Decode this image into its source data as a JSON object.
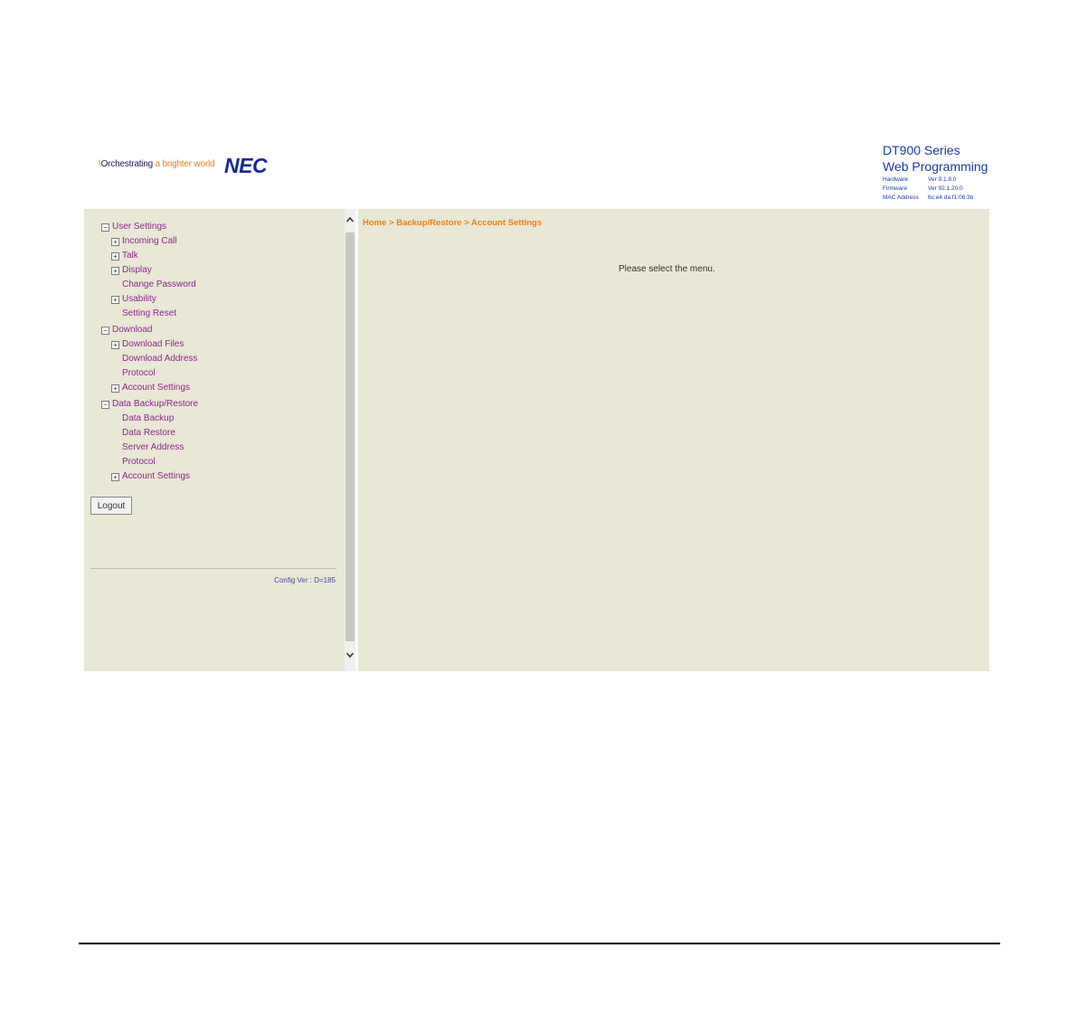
{
  "header": {
    "tagline_slash": "\\",
    "tagline_part1": "Orchestrating",
    "tagline_part2": " a brighter world",
    "logo_text": "NEC",
    "product_series": "DT900 Series",
    "product_title": "Web Programming",
    "info": [
      {
        "label": "Hardware",
        "value": "Ver 9.1.8.0"
      },
      {
        "label": "Firmware",
        "value": "Ver 92.1.20.0"
      },
      {
        "label": "MAC Address",
        "value": "6c:e4:da:f1:06:3b"
      }
    ]
  },
  "sidebar": {
    "user_settings": {
      "label": "User Settings",
      "toggle": "−",
      "items": [
        {
          "label": "Incoming Call",
          "toggle": "+"
        },
        {
          "label": "Talk",
          "toggle": "+"
        },
        {
          "label": "Display",
          "toggle": "+"
        },
        {
          "label": "Change Password"
        },
        {
          "label": "Usability",
          "toggle": "+"
        },
        {
          "label": "Setting Reset"
        }
      ]
    },
    "download": {
      "label": "Download",
      "toggle": "−",
      "items": [
        {
          "label": "Download Files",
          "toggle": "+"
        },
        {
          "label": "Download Address"
        },
        {
          "label": "Protocol"
        },
        {
          "label": "Account Settings",
          "toggle": "+"
        }
      ]
    },
    "backup": {
      "label": "Data Backup/Restore",
      "toggle": "−",
      "items": [
        {
          "label": "Data Backup"
        },
        {
          "label": "Data Restore"
        },
        {
          "label": "Server Address"
        },
        {
          "label": "Protocol"
        },
        {
          "label": "Account Settings",
          "toggle": "+"
        }
      ]
    },
    "logout_label": "Logout",
    "config_version": "Config Ver : D=185"
  },
  "scrollbar": {
    "up_icon": "^",
    "down_icon": "v"
  },
  "main": {
    "breadcrumb": "Home > Backup/Restore > Account Settings",
    "message": "Please select the menu."
  },
  "colors": {
    "panel_bg": "#e9e7d6",
    "link": "#8a2a8a",
    "breadcrumb": "#e8801a",
    "brand_blue": "#1a3aa0"
  }
}
